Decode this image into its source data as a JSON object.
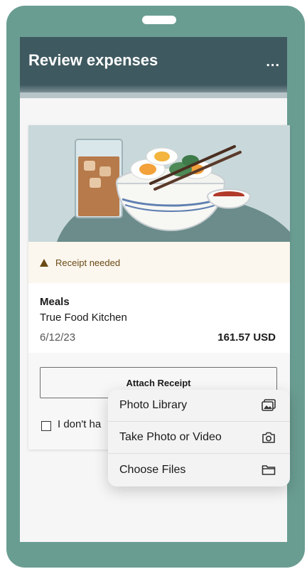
{
  "header": {
    "title": "Review expenses",
    "more_label": "..."
  },
  "expense": {
    "warning": "Receipt needed",
    "category": "Meals",
    "merchant": "True Food Kitchen",
    "date": "6/12/23",
    "amount": "161.57 USD",
    "attach_label": "Attach Receipt",
    "checkbox_label": "I don't ha"
  },
  "menu": {
    "items": [
      {
        "label": "Photo Library",
        "icon": "photo-library-icon"
      },
      {
        "label": "Take Photo or Video",
        "icon": "camera-icon"
      },
      {
        "label": "Choose Files",
        "icon": "folder-icon"
      }
    ]
  },
  "colors": {
    "frame": "#6a9d92",
    "header": "#3f5960",
    "warning_bg": "#fbf6ee",
    "warning_text": "#6a4a15"
  }
}
